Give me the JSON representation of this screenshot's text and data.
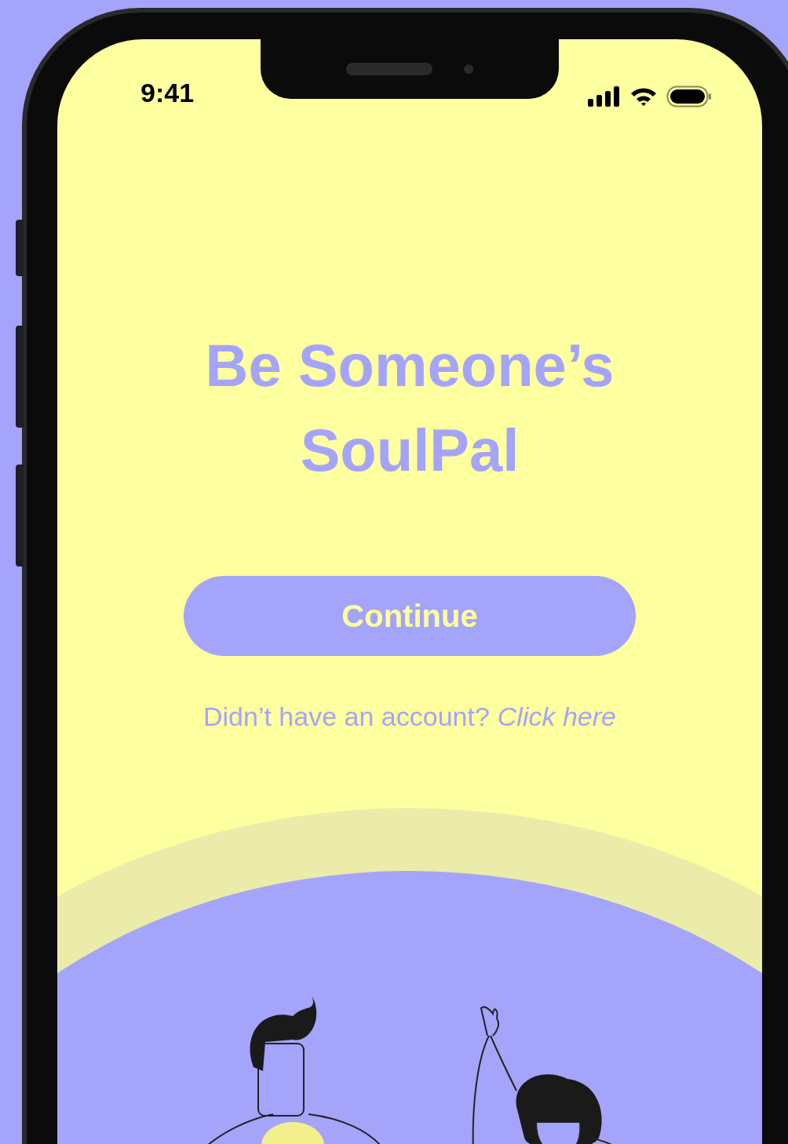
{
  "status_bar": {
    "time": "9:41"
  },
  "title": "Be Someone’s SoulPal",
  "button": {
    "label": "Continue"
  },
  "signup_prompt": {
    "text": "Didn’t have an account?",
    "link": "Click here"
  }
}
